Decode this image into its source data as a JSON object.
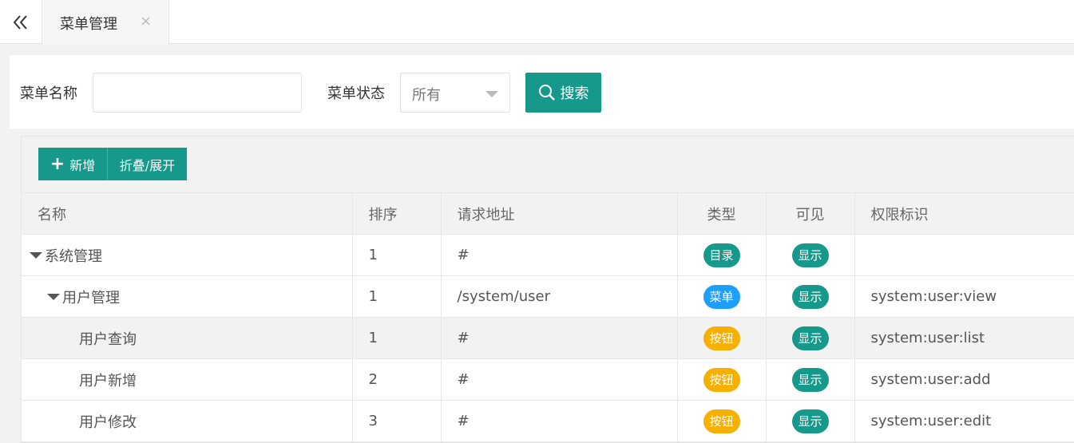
{
  "tabs": [
    {
      "label": "菜单管理",
      "close_icon": "close-icon"
    }
  ],
  "search": {
    "name_label": "菜单名称",
    "name_value": "",
    "name_placeholder": "",
    "status_label": "菜单状态",
    "status_selected": "所有",
    "search_button_label": "搜索"
  },
  "toolbar": {
    "add_label": "新增",
    "toggle_label": "折叠/展开"
  },
  "table": {
    "columns": [
      "名称",
      "排序",
      "请求地址",
      "类型",
      "可见",
      "权限标识"
    ],
    "rows": [
      {
        "name": "系统管理",
        "level": 0,
        "expanded": true,
        "order": "1",
        "url": "#",
        "type": "目录",
        "type_color": "#16998a",
        "visible": "显示",
        "perm": ""
      },
      {
        "name": "用户管理",
        "level": 1,
        "expanded": true,
        "order": "1",
        "url": "/system/user",
        "type": "菜单",
        "type_color": "#1e9fff",
        "visible": "显示",
        "perm": "system:user:view"
      },
      {
        "name": "用户查询",
        "level": 2,
        "expanded": false,
        "order": "1",
        "url": "#",
        "type": "按钮",
        "type_color": "#f5b000",
        "visible": "显示",
        "perm": "system:user:list"
      },
      {
        "name": "用户新增",
        "level": 2,
        "expanded": false,
        "order": "2",
        "url": "#",
        "type": "按钮",
        "type_color": "#f5b000",
        "visible": "显示",
        "perm": "system:user:add"
      },
      {
        "name": "用户修改",
        "level": 2,
        "expanded": false,
        "order": "3",
        "url": "#",
        "type": "按钮",
        "type_color": "#f5b000",
        "visible": "显示",
        "perm": "system:user:edit"
      }
    ],
    "visible_color": "#16998a"
  },
  "colors": {
    "primary": "#16998a",
    "menu_badge": "#1e9fff",
    "button_badge": "#f5b000"
  }
}
